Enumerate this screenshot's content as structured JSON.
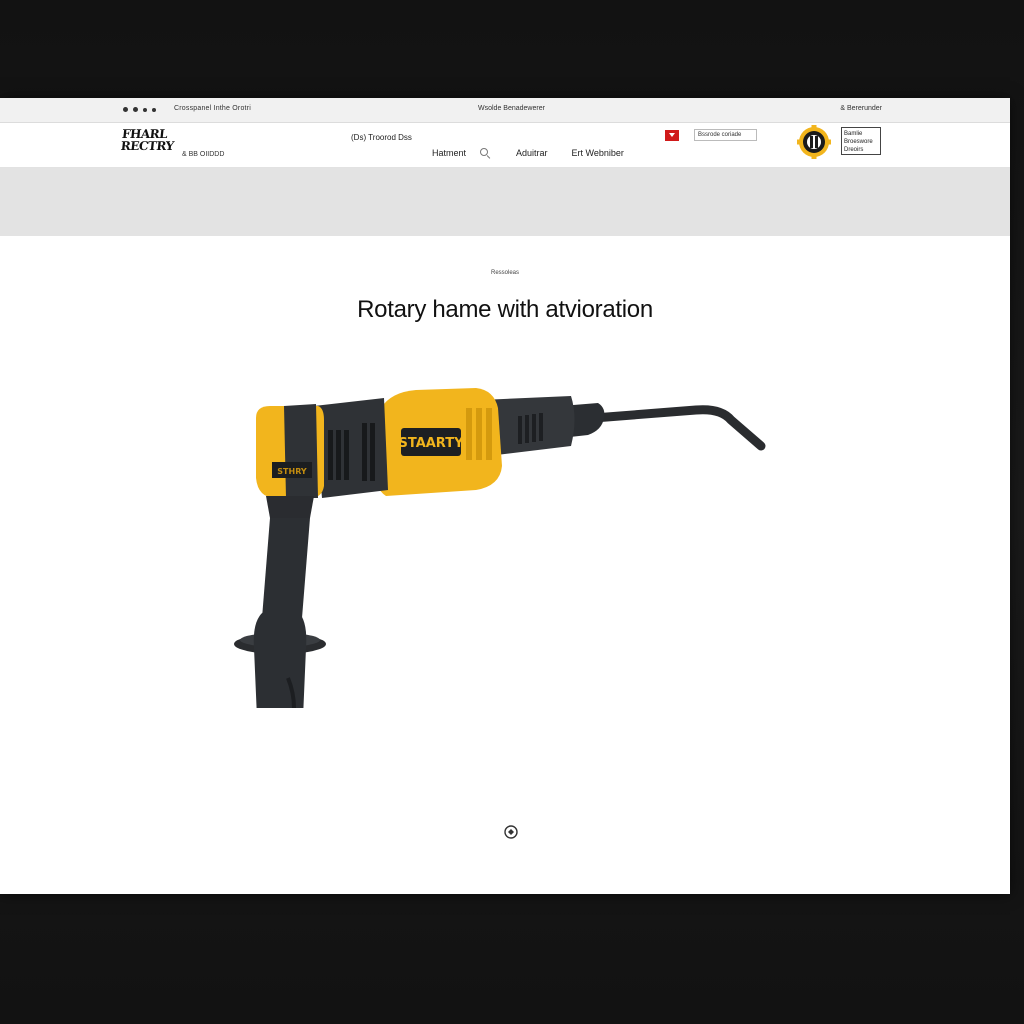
{
  "topbar": {
    "left_text": "Crosspanel Inthe Orotri",
    "center_text": "Wsolde Benadewerer",
    "right_text": "& Bererunder"
  },
  "header": {
    "logo_line1": "FHARL",
    "logo_line2": "RECTRY",
    "logo_tagline": "& BB OIIDDD",
    "phone": "(Ds) Troorod Dss",
    "nav": [
      {
        "label": "Hatment"
      },
      {
        "label": "Aduitrar"
      },
      {
        "label": "Ert Webniber"
      }
    ],
    "lang_select": "Bssrode coriade",
    "account_lines": [
      "Bamlie",
      "Broeswore",
      "Dreoirs"
    ]
  },
  "product": {
    "breadcrumb": "Ressoleas",
    "title": "Rotary hame with atvioration",
    "brand_label": "STAARTY",
    "front_label": "STHRY"
  },
  "colors": {
    "accent": "#f2b51d",
    "body_dark": "#2c2f33",
    "flag_red": "#d01a1a"
  }
}
